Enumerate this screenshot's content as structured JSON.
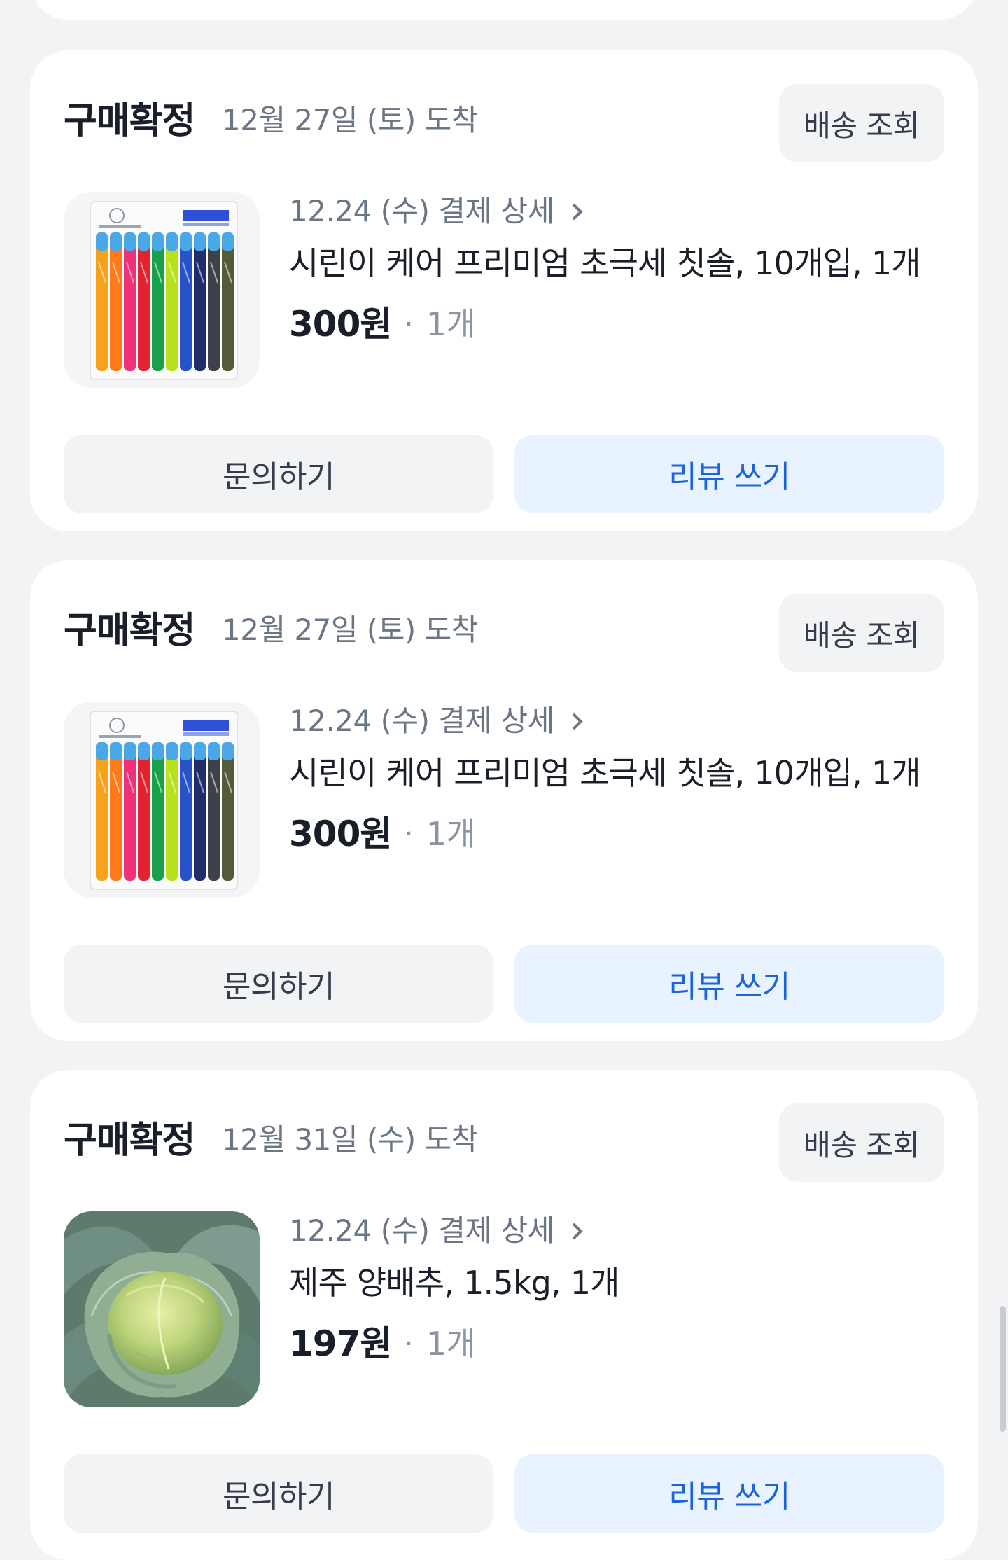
{
  "orders": [
    {
      "status": "구매확정",
      "arrival": "12월 27일 (토) 도착",
      "track_label": "배송 조회",
      "payment_detail": "12.24 (수) 결제 상세",
      "product_name": "시린이 케어 프리미엄 초극세 칫솔, 10개입, 1개",
      "price": "300원",
      "separator": "·",
      "quantity": "1개",
      "image": "toothbrush-pack",
      "inquiry_label": "문의하기",
      "review_label": "리뷰 쓰기"
    },
    {
      "status": "구매확정",
      "arrival": "12월 27일 (토) 도착",
      "track_label": "배송 조회",
      "payment_detail": "12.24 (수) 결제 상세",
      "product_name": "시린이 케어 프리미엄 초극세 칫솔, 10개입, 1개",
      "price": "300원",
      "separator": "·",
      "quantity": "1개",
      "image": "toothbrush-pack",
      "inquiry_label": "문의하기",
      "review_label": "리뷰 쓰기"
    },
    {
      "status": "구매확정",
      "arrival": "12월 31일 (수) 도착",
      "track_label": "배송 조회",
      "payment_detail": "12.24 (수) 결제 상세",
      "product_name": "제주 양배추, 1.5kg, 1개",
      "price": "197원",
      "separator": "·",
      "quantity": "1개",
      "image": "cabbage",
      "inquiry_label": "문의하기",
      "review_label": "리뷰 쓰기"
    }
  ],
  "colors": {
    "background": "#f2f3f5",
    "card": "#ffffff",
    "review_button_bg": "#e8f3ff",
    "review_button_text": "#1b64da",
    "secondary_text": "#6b7684"
  }
}
